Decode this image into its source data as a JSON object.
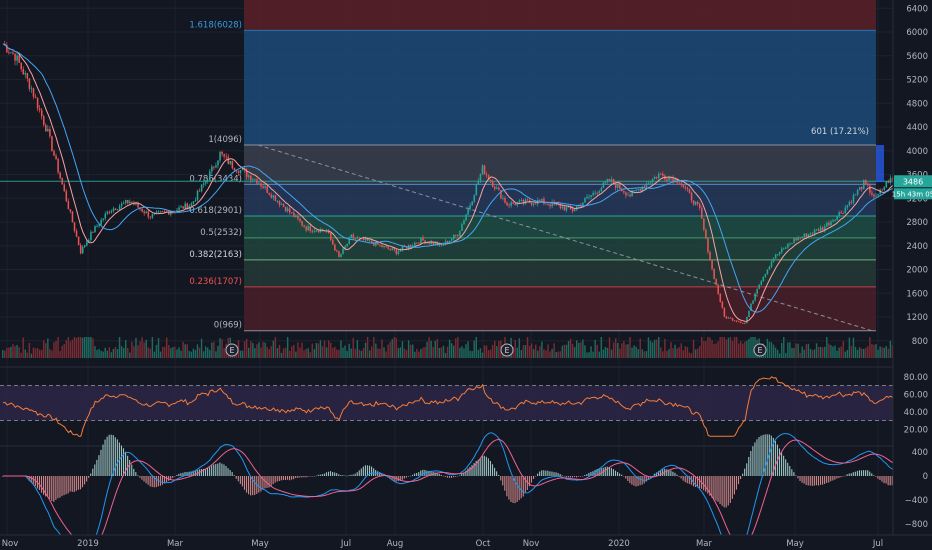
{
  "chart_data": [
    {
      "type": "candlestick",
      "panel": "price",
      "ylim": [
        600,
        6500
      ],
      "y_ticks": [
        800,
        1200,
        1600,
        2000,
        2400,
        2800,
        3200,
        3600,
        4000,
        4400,
        4800,
        5200,
        5600,
        6000,
        6400
      ],
      "x_labels": [
        "Nov",
        "2019",
        "Mar",
        "May",
        "Jul",
        "Aug",
        "Oct",
        "Nov",
        "2020",
        "Mar",
        "May",
        "Jul"
      ],
      "ohlc_keypoints": [
        [
          0,
          5800
        ],
        [
          6,
          5600
        ],
        [
          14,
          5050
        ],
        [
          22,
          4300
        ],
        [
          30,
          3300
        ],
        [
          38,
          2300
        ],
        [
          44,
          2650
        ],
        [
          52,
          3000
        ],
        [
          62,
          3150
        ],
        [
          72,
          2900
        ],
        [
          84,
          3000
        ],
        [
          92,
          3100
        ],
        [
          100,
          3550
        ],
        [
          106,
          3950
        ],
        [
          112,
          3750
        ],
        [
          124,
          3500
        ],
        [
          136,
          3100
        ],
        [
          148,
          2700
        ],
        [
          158,
          2650
        ],
        [
          164,
          2200
        ],
        [
          170,
          2550
        ],
        [
          180,
          2450
        ],
        [
          192,
          2300
        ],
        [
          204,
          2500
        ],
        [
          214,
          2400
        ],
        [
          222,
          2600
        ],
        [
          228,
          3100
        ],
        [
          234,
          3700
        ],
        [
          246,
          3100
        ],
        [
          262,
          3150
        ],
        [
          278,
          3000
        ],
        [
          296,
          3500
        ],
        [
          306,
          3250
        ],
        [
          320,
          3600
        ],
        [
          330,
          3500
        ],
        [
          340,
          3000
        ],
        [
          346,
          2000
        ],
        [
          352,
          1200
        ],
        [
          362,
          1100
        ],
        [
          368,
          1700
        ],
        [
          376,
          2200
        ],
        [
          386,
          2500
        ],
        [
          400,
          2700
        ],
        [
          410,
          3000
        ],
        [
          420,
          3450
        ],
        [
          426,
          3200
        ],
        [
          432,
          3500
        ]
      ],
      "volume_markers": [
        "E",
        "E",
        "E"
      ],
      "fibonacci_levels": [
        {
          "level": "1.618",
          "price": 6028,
          "label": "1.618(6028)"
        },
        {
          "level": "1",
          "price": 4096,
          "label": "1(4096)"
        },
        {
          "level": "0.786",
          "price": 3434,
          "label": "0.786(3434)"
        },
        {
          "level": "0.618",
          "price": 2901,
          "label": "0.618(2901)"
        },
        {
          "level": "0.5",
          "price": 2532,
          "label": "0.5(2532)"
        },
        {
          "level": "0.382",
          "price": 2163,
          "label": "0.382(2163)"
        },
        {
          "level": "0.236",
          "price": 1707,
          "label": "0.236(1707)"
        },
        {
          "level": "0",
          "price": 969,
          "label": "0(969)"
        }
      ],
      "measure_label": "601 (17.21%)",
      "last_price_label": "3486",
      "countdown_label": "15h 43m 05"
    },
    {
      "type": "line",
      "panel": "oscillator",
      "ylim": [
        10,
        90
      ],
      "y_ticks": [
        20.0,
        40.0,
        60.0,
        80.0
      ],
      "y_tick_labels": [
        "20.00",
        "40.00",
        "60.00",
        "80.00"
      ],
      "band_upper": 70,
      "band_lower": 30
    },
    {
      "type": "histogram",
      "panel": "macd",
      "ylim": [
        -900,
        450
      ],
      "y_ticks": [
        400,
        0,
        -400,
        -800
      ],
      "y_tick_labels": [
        "400",
        "0",
        "−400",
        "−800"
      ]
    }
  ]
}
